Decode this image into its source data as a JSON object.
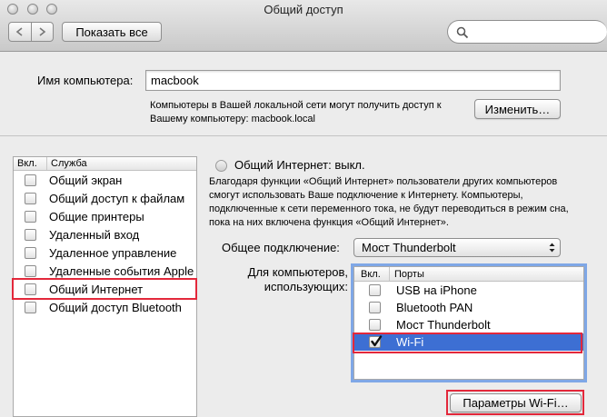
{
  "window": {
    "title": "Общий доступ",
    "show_all_label": "Показать все"
  },
  "computer_name": {
    "label": "Имя компьютера:",
    "value": "macbook",
    "description": "Компьютеры в Вашей локальной сети могут получить доступ к Вашему компьютеру: macbook.local",
    "edit_button": "Изменить…"
  },
  "services": {
    "header_on": "Вкл.",
    "header_service": "Служба",
    "items": [
      {
        "label": "Общий экран",
        "checked": false
      },
      {
        "label": "Общий доступ к файлам",
        "checked": false
      },
      {
        "label": "Общие принтеры",
        "checked": false
      },
      {
        "label": "Удаленный вход",
        "checked": false
      },
      {
        "label": "Удаленное управление",
        "checked": false
      },
      {
        "label": "Удаленные события Apple",
        "checked": false
      },
      {
        "label": "Общий Интернет",
        "checked": false,
        "highlighted": true
      },
      {
        "label": "Общий доступ Bluetooth",
        "checked": false
      }
    ]
  },
  "internet_sharing": {
    "status": "Общий Интернет: выкл.",
    "description": "Благодаря функции «Общий Интернет» пользователи других компьютеров смогут использовать Ваше подключение к Интернету. Компьютеры, подключенные к сети переменного тока, не будут переводиться в режим сна, пока на них включена функция «Общий Интернет».",
    "share_from_label": "Общее подключение:",
    "share_from_value": "Мост Thunderbolt",
    "to_computers_label_1": "Для компьютеров,",
    "to_computers_label_2": "использующих:",
    "ports_header_on": "Вкл.",
    "ports_header_ports": "Порты",
    "ports": [
      {
        "label": "USB на iPhone",
        "checked": false
      },
      {
        "label": "Bluetooth PAN",
        "checked": false
      },
      {
        "label": "Мост Thunderbolt",
        "checked": false
      },
      {
        "label": "Wi-Fi",
        "checked": true,
        "selected": true
      }
    ],
    "wifi_options_button": "Параметры Wi-Fi…"
  },
  "colors": {
    "annotation_red": "#e3283b",
    "selection_blue": "#3d6fd3"
  }
}
